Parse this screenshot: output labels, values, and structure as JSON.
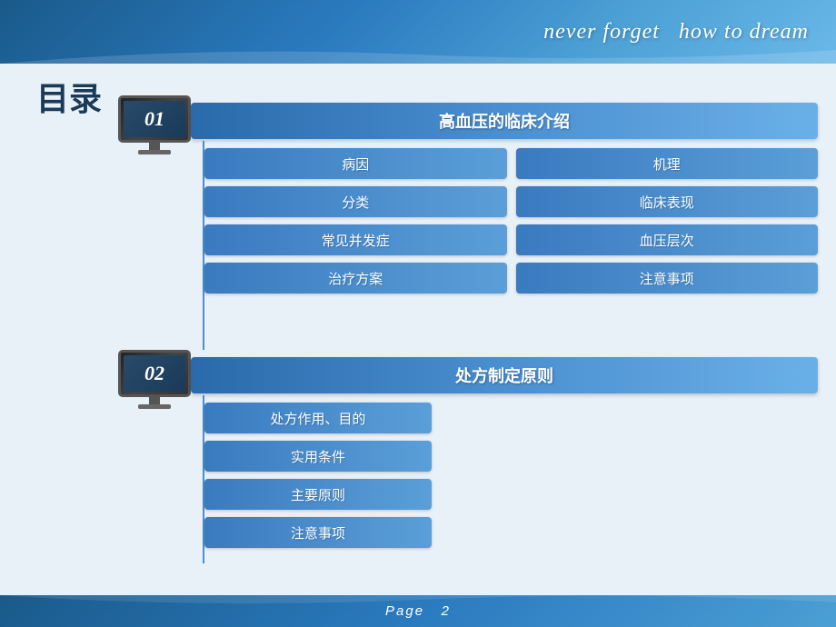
{
  "header": {
    "banner_text_1": "never forget",
    "banner_text_2": "how to dream"
  },
  "page_title": "目录",
  "footer": {
    "label": "Page",
    "page_number": "2"
  },
  "section_01": {
    "number": "01",
    "title": "高血压的临床介绍",
    "sub_items_left": [
      "病因",
      "分类",
      "常见并发症",
      "治疗方案"
    ],
    "sub_items_right": [
      "机理",
      "临床表现",
      "血压层次",
      "注意事项"
    ]
  },
  "section_02": {
    "number": "02",
    "title": "处方制定原则",
    "sub_items": [
      "处方作用、目的",
      "实用条件",
      "主要原则",
      "注意事项"
    ]
  }
}
